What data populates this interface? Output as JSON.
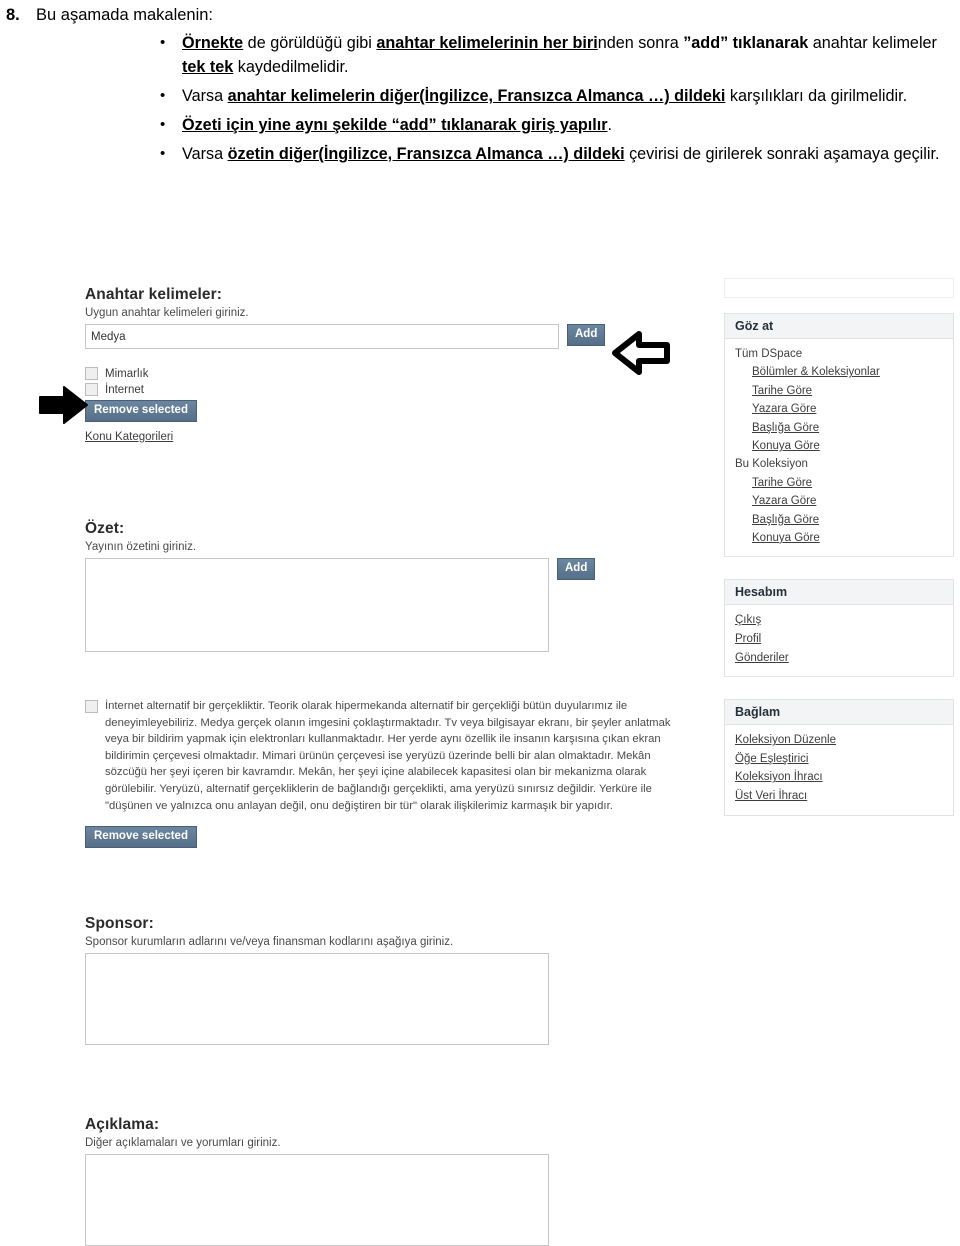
{
  "document": {
    "item_number": "8.",
    "item_text": "Bu aşamada makalenin:",
    "bullets": [
      {
        "segments": [
          {
            "text": "Örnekte",
            "style": "bold-underline"
          },
          {
            "text": " de görüldüğü gibi ",
            "style": "plain"
          },
          {
            "text": "anahtar kelimelerinin her biri",
            "style": "bold-underline"
          },
          {
            "text": "nden sonra ",
            "style": "plain"
          },
          {
            "text": "”add” tıklanarak",
            "style": "bold"
          },
          {
            "text": " anahtar kelimeler ",
            "style": "plain"
          },
          {
            "text": "tek tek",
            "style": "bold-underline"
          },
          {
            "text": " kaydedilmelidir.",
            "style": "plain"
          }
        ]
      },
      {
        "segments": [
          {
            "text": "Varsa ",
            "style": "plain"
          },
          {
            "text": "anahtar kelimelerin diğer(İngilizce, Fransızca Almanca …) dildeki",
            "style": "bold-underline"
          },
          {
            "text": " karşılıkları da girilmelidir.",
            "style": "plain"
          }
        ]
      },
      {
        "segments": [
          {
            "text": "Özeti için yine aynı şekilde “add” tıklanarak giriş yapılır",
            "style": "bold-underline"
          },
          {
            "text": ".",
            "style": "plain"
          }
        ]
      },
      {
        "segments": [
          {
            "text": "Varsa ",
            "style": "plain"
          },
          {
            "text": "özetin diğer(İngilizce, Fransızca Almanca …) dildeki",
            "style": "bold-underline"
          },
          {
            "text": " çevirisi de girilerek sonraki aşamaya geçilir.",
            "style": "plain"
          }
        ]
      }
    ]
  },
  "screenshot": {
    "keywords": {
      "label": "Anahtar kelimeler:",
      "hint": "Uygun anahtar kelimeleri giriniz.",
      "input_value": "Medya",
      "input_placeholder": "",
      "add_button": "Add",
      "checkbox_items": [
        "Mimarlık",
        "İnternet"
      ],
      "remove_button": "Remove selected",
      "category_link": "Konu Kategorileri"
    },
    "abstract": {
      "label": "Özet:",
      "hint": "Yayının özetini giriniz.",
      "textarea_value": "",
      "add_button": "Add",
      "entry_text": "İnternet alternatif bir gerçekliktir. Teorik olarak hipermekanda alternatif bir gerçekliği bütün duyularımız ile deneyimleyebiliriz. Medya gerçek olanın imgesini çoklaştırmaktadır. Tv veya bilgisayar ekranı, bir şeyler anlatmak veya bir bildirim yapmak için elektronları kullanmaktadır. Her yerde aynı özellik ile insanın karşısına çıkan ekran bildirimin çerçevesi olmaktadır. Mimari ürünün çerçevesi ise yeryüzü üzerinde belli bir alan olmaktadır. Mekân sözcüğü her şeyi içeren bir kavramdır. Mekân, her şeyi içine alabilecek kapasitesi olan bir mekanizma olarak görülebilir. Yeryüzü, alternatif gerçekliklerin de bağlandığı gerçeklikti, ama yeryüzü sınırsız değildir. Yerküre ile \"düşünen ve yalnızca onu anlayan değil, onu değiştiren bir tür\" olarak ilişkilerimiz karmaşık bir yapıdır.",
      "remove_button": "Remove selected"
    },
    "sponsor": {
      "label": "Sponsor:",
      "hint": "Sponsor kurumların adlarını ve/veya finansman kodlarını aşağıya giriniz.",
      "textarea_value": ""
    },
    "description": {
      "label": "Açıklama:",
      "hint": "Diğer açıklamaları ve yorumları giriniz.",
      "textarea_value": ""
    },
    "sidebar": {
      "browse": {
        "title": "Göz at",
        "group_all_label": "Tüm DSpace",
        "group_all_links": [
          "Bölümler & Koleksiyonlar",
          "Tarihe Göre",
          "Yazara Göre",
          "Başlığa Göre",
          "Konuya Göre"
        ],
        "group_collection_label": "Bu Koleksiyon",
        "group_collection_links": [
          "Tarihe Göre",
          "Yazara Göre",
          "Başlığa Göre",
          "Konuya Göre"
        ]
      },
      "account": {
        "title": "Hesabım",
        "links": [
          "Çıkış",
          "Profil",
          "Gönderiler"
        ]
      },
      "context": {
        "title": "Bağlam",
        "links": [
          "Koleksiyon Düzenle",
          "Öğe Eşleştirici",
          "Koleksiyon İhracı",
          "Üst Veri İhracı"
        ]
      }
    },
    "annotations": {
      "arrow_left_label": "arrow pointing right at keyword checkboxes",
      "arrow_right_label": "arrow pointing left at Add button"
    },
    "colors": {
      "button": "#5f7b96",
      "panel_header_bg": "#f3f4f5",
      "panel_border": "#e2e2e2",
      "input_border": "#c6c6c6"
    }
  }
}
